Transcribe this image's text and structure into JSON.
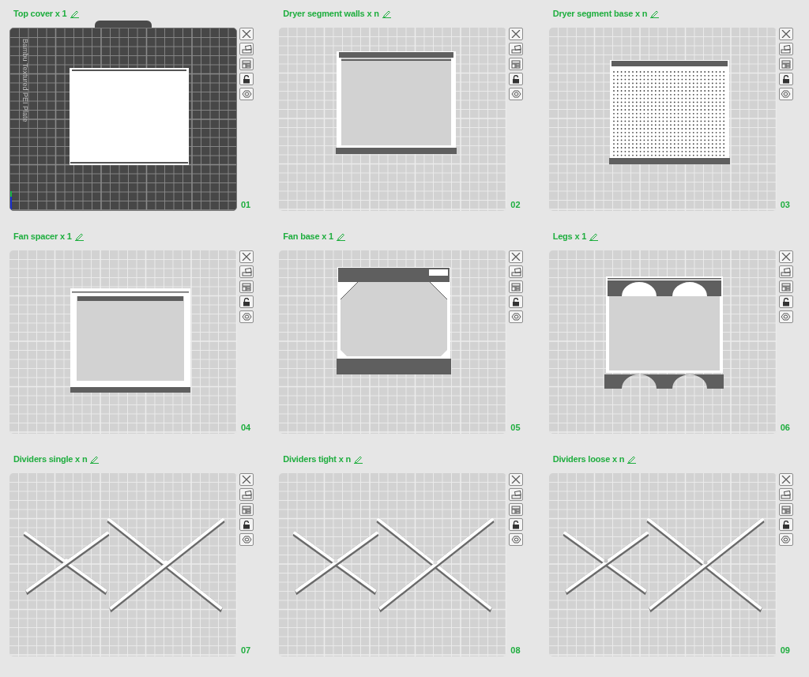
{
  "plates": [
    {
      "title": "Top cover x 1",
      "number": "01",
      "selected": true,
      "bed_label": "Bambu Textured PEI Plate",
      "model": {
        "kind": "cover"
      }
    },
    {
      "title": "Dryer segment walls x n",
      "number": "02",
      "selected": false,
      "model": {
        "kind": "walls"
      }
    },
    {
      "title": "Dryer segment base x n",
      "number": "03",
      "selected": false,
      "model": {
        "kind": "perforated"
      }
    },
    {
      "title": "Fan spacer x 1",
      "number": "04",
      "selected": false,
      "model": {
        "kind": "spacer"
      }
    },
    {
      "title": "Fan base x 1",
      "number": "05",
      "selected": false,
      "model": {
        "kind": "fan_base"
      }
    },
    {
      "title": "Legs x 1",
      "number": "06",
      "selected": false,
      "model": {
        "kind": "legs"
      }
    },
    {
      "title": "Dividers single x n",
      "number": "07",
      "selected": false,
      "model": {
        "kind": "dividers"
      }
    },
    {
      "title": "Dividers tight x n",
      "number": "08",
      "selected": false,
      "model": {
        "kind": "dividers_tight"
      }
    },
    {
      "title": "Dividers loose x n",
      "number": "09",
      "selected": false,
      "model": {
        "kind": "dividers_loose"
      }
    }
  ]
}
